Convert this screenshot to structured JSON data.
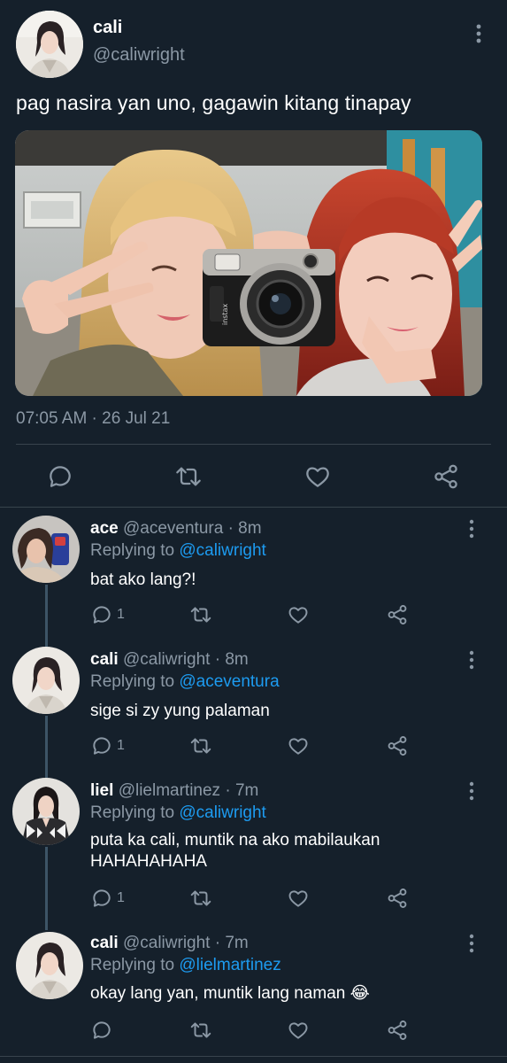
{
  "main": {
    "name": "cali",
    "handle": "@caliwright",
    "text": "pag nasira yan uno, gagawin kitang tinapay",
    "timestamp": "07:05 AM · 26 Jul 21",
    "media": {
      "camera_brand": "instax",
      "camera_model": "mini 90"
    },
    "actions": [
      "reply-icon",
      "retweet-icon",
      "like-icon",
      "share-icon"
    ]
  },
  "replies": [
    {
      "name": "ace",
      "handle": "@aceventura",
      "time": "· 8m",
      "replying_prefix": "Replying to",
      "replying_to": "@caliwright",
      "text": "bat ako lang?!",
      "reply_count": "1"
    },
    {
      "name": "cali",
      "handle": "@caliwright",
      "time": "· 8m",
      "replying_prefix": "Replying to",
      "replying_to": "@aceventura",
      "text": "sige si zy yung palaman",
      "reply_count": "1"
    },
    {
      "name": "liel",
      "handle": "@lielmartinez",
      "time": "· 7m",
      "replying_prefix": "Replying to",
      "replying_to": "@caliwright",
      "text": "puta ka cali, muntik na ako mabilaukan HAHAHAHAHA",
      "reply_count": "1"
    },
    {
      "name": "cali",
      "handle": "@caliwright",
      "time": "· 7m",
      "replying_prefix": "Replying to",
      "replying_to": "@lielmartinez",
      "text": "okay lang yan, muntik lang naman 😂",
      "reply_count": ""
    }
  ],
  "colors": {
    "background": "#15202b",
    "text": "#ffffff",
    "secondary": "#8b98a5",
    "link": "#1d9bf0",
    "divider": "#38444d",
    "thread_line": "#3d5466"
  }
}
